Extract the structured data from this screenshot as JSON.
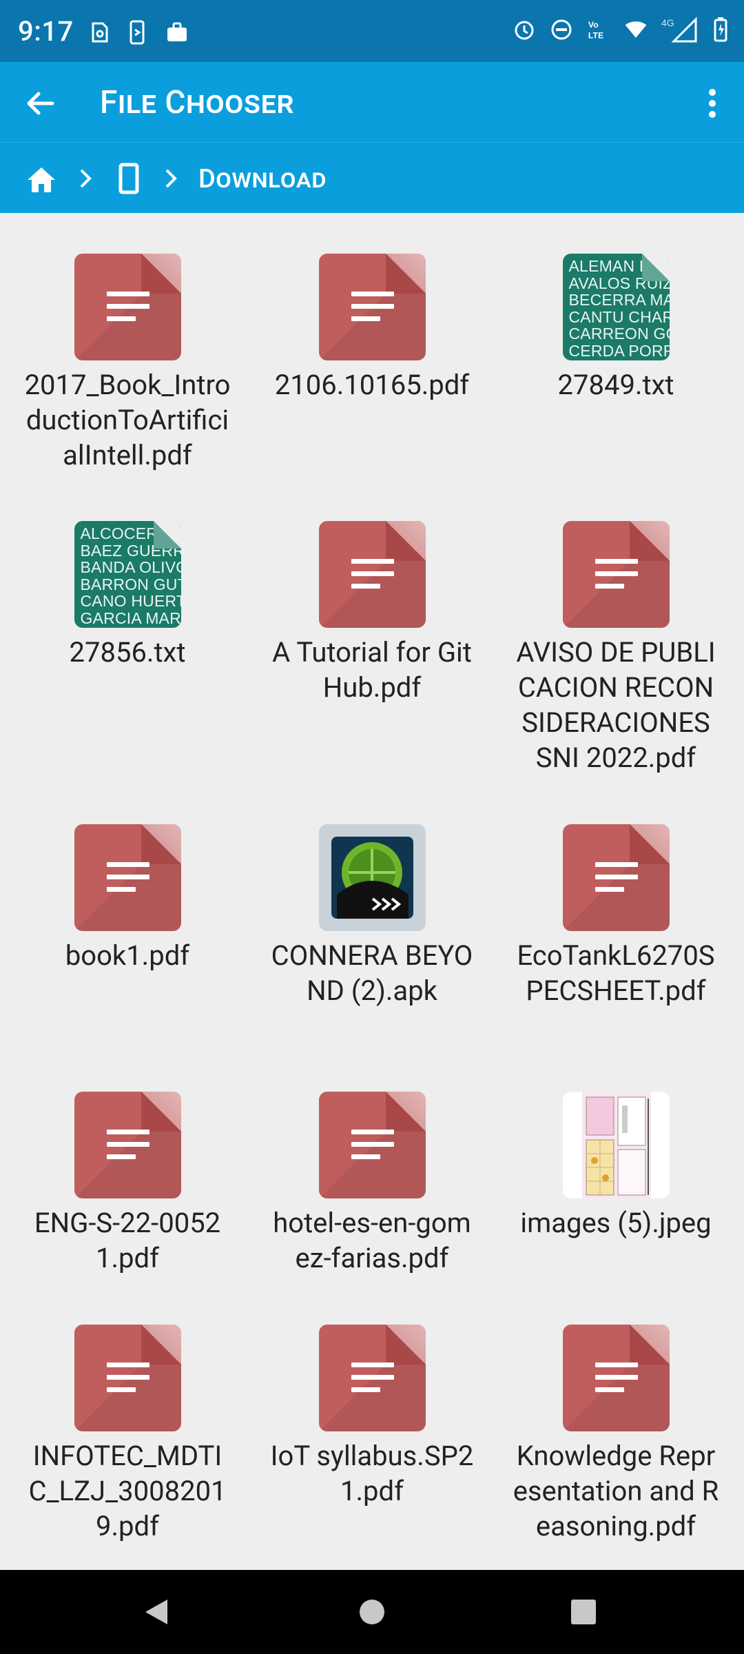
{
  "status_bar": {
    "time": "9:17",
    "left_icons": [
      "sim-settings-icon",
      "phone-sync-icon",
      "work-briefcase-icon"
    ],
    "right_icons": [
      "alarm-icon",
      "do-not-disturb-icon",
      "volte-icon",
      "wifi-icon",
      "4g-signal-icon",
      "battery-icon"
    ]
  },
  "app_bar": {
    "title": "File Chooser",
    "back_icon": "arrow-back-icon",
    "menu_icon": "more-vert-icon"
  },
  "breadcrumb": {
    "home_icon": "home-icon",
    "device_icon": "phone-device-icon",
    "current": "Download"
  },
  "files": [
    {
      "name": "2017_Book_IntroductionToArtificialIntell.pdf",
      "type": "pdf"
    },
    {
      "name": "2106.10165.pdf",
      "type": "pdf"
    },
    {
      "name": "27849.txt",
      "type": "txt",
      "preview": [
        "ALEMAN D",
        "AVALOS RUIZ",
        "BECERRA MA",
        "CANTU CHAR",
        "CARREON GO",
        "CERDA PORR"
      ]
    },
    {
      "name": "27856.txt",
      "type": "txt",
      "preview": [
        "ALCOCER M",
        "BAEZ GUERR",
        "BANDA OLIVO",
        "BARRON GUT",
        "CANO HUERT",
        "GARCIA MAR"
      ]
    },
    {
      "name": "A Tutorial for GitHub.pdf",
      "type": "pdf"
    },
    {
      "name": "AVISO DE PUBLICACION RECONSIDERACIONES SNI 2022.pdf",
      "type": "pdf"
    },
    {
      "name": "book1.pdf",
      "type": "pdf"
    },
    {
      "name": "CONNERA BEYOND (2).apk",
      "type": "apk"
    },
    {
      "name": "EcoTankL6270SPECSHEET.pdf",
      "type": "pdf"
    },
    {
      "name": "ENG-S-22-00521.pdf",
      "type": "pdf"
    },
    {
      "name": "hotel-es-en-gomez-farias.pdf",
      "type": "pdf"
    },
    {
      "name": "images (5).jpeg",
      "type": "jpeg"
    },
    {
      "name": "INFOTEC_MDTIC_LZJ_30082019.pdf",
      "type": "pdf"
    },
    {
      "name": "IoT syllabus.SP21.pdf",
      "type": "pdf"
    },
    {
      "name": "Knowledge Representation and Reasoning.pdf",
      "type": "pdf"
    }
  ],
  "nav_bar": {
    "back_icon": "nav-back-icon",
    "home_icon": "nav-home-icon",
    "recents_icon": "nav-recents-icon"
  }
}
